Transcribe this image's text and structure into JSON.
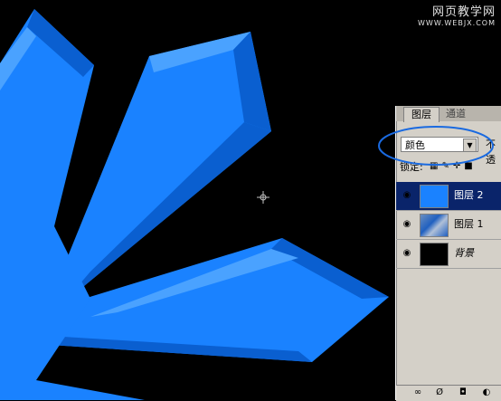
{
  "watermark": {
    "title": "网页教学网",
    "url": "WWW.WEBJX.COM"
  },
  "layers_panel": {
    "tabs": [
      {
        "label": "图层",
        "active": true
      },
      {
        "label": "通道",
        "active": false
      }
    ],
    "blend_mode": "颜色",
    "opacity_label": "不透",
    "lock_label": "锁定:",
    "lock_icons": [
      "transparency-lock-icon",
      "brush-lock-icon",
      "move-lock-icon",
      "padlock-icon"
    ],
    "layers": [
      {
        "name": "图层 2",
        "selected": true,
        "thumbnail_color": "#1a82ff",
        "visible": true
      },
      {
        "name": "图层 1",
        "selected": false,
        "thumbnail_color": "#2060c0",
        "visible": true
      },
      {
        "name": "背景",
        "selected": false,
        "thumbnail_color": "#000000",
        "visible": true
      }
    ],
    "bottom_icons": [
      "link-icon",
      "style-icon",
      "mask-icon",
      "adjustment-icon"
    ]
  },
  "colors": {
    "canvas_bg": "#000000",
    "shape_main": "#1a82ff",
    "shape_dark": "#0a5fd0",
    "shape_light": "#4aa2ff",
    "selection_highlight": "#0a246a",
    "annotation_ellipse": "#1a6ae0"
  }
}
